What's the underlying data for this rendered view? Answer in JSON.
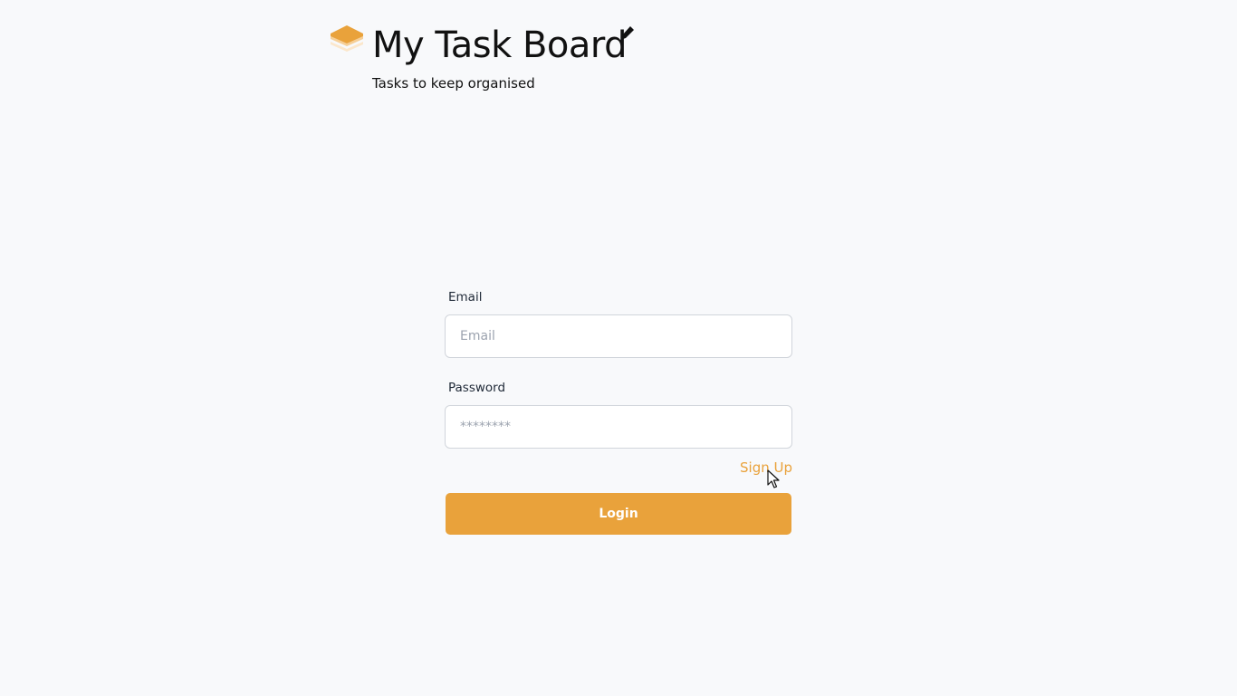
{
  "header": {
    "logo_icon": "stacked-layers-icon",
    "title": "My Task Board",
    "title_icon": "pen-icon",
    "subtitle": "Tasks to keep organised"
  },
  "login_form": {
    "email": {
      "label": "Email",
      "placeholder": "Email",
      "value": ""
    },
    "password": {
      "label": "Password",
      "placeholder": "********",
      "value": ""
    },
    "signup_label": "Sign Up",
    "login_label": "Login"
  },
  "colors": {
    "background": "#f8f9fb",
    "accent": "#e9a23b",
    "text": "#111111",
    "input_border": "#d1d5db"
  }
}
